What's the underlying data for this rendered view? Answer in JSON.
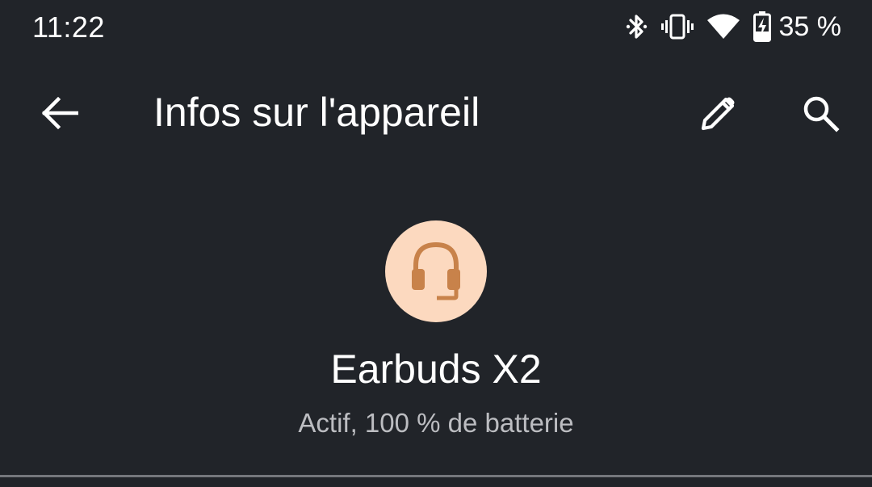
{
  "status_bar": {
    "time": "11:22",
    "battery_percent": "35 %",
    "icons": [
      "bluetooth-icon",
      "vibrate-icon",
      "wifi-icon",
      "battery-charging-icon"
    ]
  },
  "app_bar": {
    "title": "Infos sur l'appareil",
    "back_icon": "arrow-left-icon",
    "edit_icon": "pencil-icon",
    "search_icon": "search-icon"
  },
  "device": {
    "name": "Earbuds X2",
    "status": "Actif, 100 % de batterie",
    "icon": "headset-icon"
  },
  "colors": {
    "background": "#212429",
    "avatar_bg": "#fcd9bf",
    "avatar_icon": "#c8824a",
    "secondary_text": "#bcbdc1"
  }
}
